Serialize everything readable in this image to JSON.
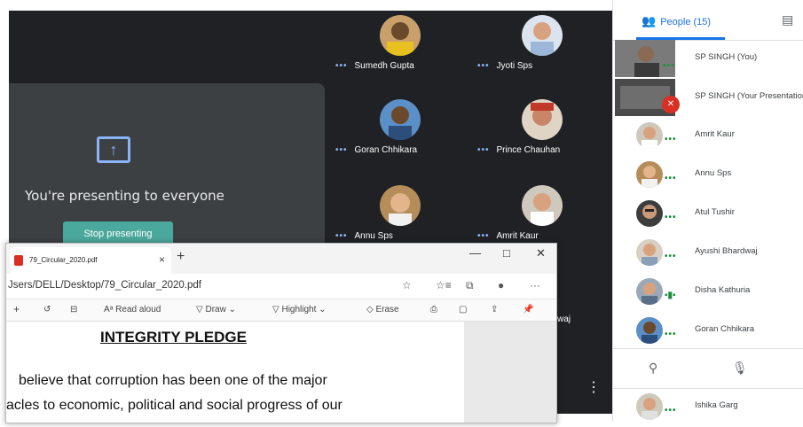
{
  "meeting": {
    "presenting_text": "You're presenting to everyone",
    "stop_label": "Stop presenting",
    "tiles": [
      {
        "name": "Sumedh Gupta"
      },
      {
        "name": "Jyoti Sps"
      },
      {
        "name": "Goran Chhikara"
      },
      {
        "name": "Prince Chauhan"
      },
      {
        "name": "Annu Sps"
      },
      {
        "name": "Amrit Kaur"
      }
    ],
    "more_icon": "more-vert-icon",
    "partial_name": "waj"
  },
  "sidebar": {
    "people_tab": "People (15)",
    "people": [
      {
        "name": "SP SINGH (You)"
      },
      {
        "name": "SP SINGH (Your Presentation)"
      },
      {
        "name": "Amrit Kaur"
      },
      {
        "name": "Annu Sps"
      },
      {
        "name": "Atul Tushir"
      },
      {
        "name": "Ayushi Bhardwaj"
      },
      {
        "name": "Disha Kathuria"
      },
      {
        "name": "Goran Chhikara"
      },
      {
        "name": "Ishika Garg"
      }
    ]
  },
  "pdf_viewer": {
    "tab_title": "79_Circular_2020.pdf",
    "url": "Jsers/DELL/Desktop/79_Circular_2020.pdf",
    "tools": {
      "read_aloud": "Read aloud",
      "draw": "Draw",
      "highlight": "Highlight",
      "erase": "Erase"
    },
    "heading": "INTEGRITY PLEDGE",
    "line1": "believe that corruption has been one of the major",
    "line2": "acles to economic, political and social progress of our"
  }
}
